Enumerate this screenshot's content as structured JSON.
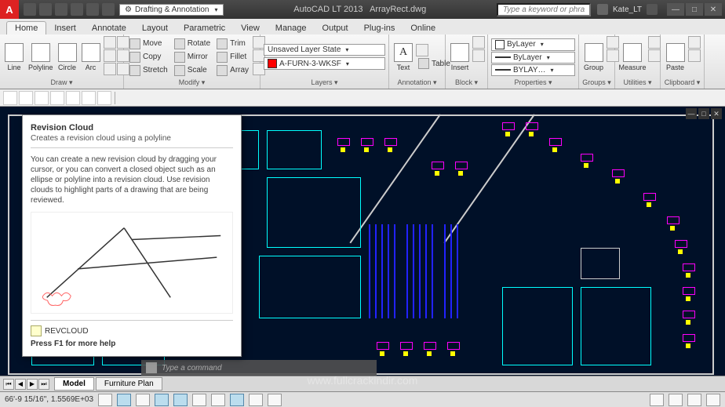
{
  "title": {
    "app": "AutoCAD LT 2013",
    "doc": "ArrayRect.dwg"
  },
  "workspace": "Drafting & Annotation",
  "search_placeholder": "Type a keyword or phrase",
  "user": "Kate_LT",
  "ribbon": {
    "tabs": [
      "Home",
      "Insert",
      "Annotate",
      "Layout",
      "Parametric",
      "View",
      "Manage",
      "Output",
      "Plug-ins",
      "Online"
    ],
    "active": 0,
    "draw": {
      "line": "Line",
      "polyline": "Polyline",
      "circle": "Circle",
      "arc": "Arc",
      "title": "Draw ▾"
    },
    "modify": {
      "row1": [
        "Move",
        "Rotate",
        "Trim"
      ],
      "row2": [
        "Copy",
        "Mirror",
        "Fillet"
      ],
      "row3": [
        "Stretch",
        "Scale",
        "Array"
      ],
      "title": "Modify ▾"
    },
    "layers": {
      "state": "Unsaved Layer State",
      "current": "A-FURN-3-WKSF",
      "title": "Layers ▾"
    },
    "annotation": {
      "text": "Text",
      "table": "Table",
      "title": "Annotation ▾"
    },
    "block": {
      "insert": "Insert",
      "title": "Block ▾"
    },
    "properties": {
      "row1": "ByLayer",
      "row2": "ByLayer",
      "row3": "BYLAY…",
      "title": "Properties ▾"
    },
    "groups": {
      "group": "Group",
      "title": "Groups ▾"
    },
    "utilities": {
      "measure": "Measure",
      "title": "Utilities ▾"
    },
    "clipboard": {
      "paste": "Paste",
      "title": "Clipboard ▾"
    }
  },
  "tooltip": {
    "title": "Revision Cloud",
    "subtitle": "Creates a revision cloud using a polyline",
    "description": "You can create a new revision cloud by dragging your cursor, or you can convert a closed object such as an ellipse or polyline into a revision cloud. Use revision clouds to highlight parts of a drawing that are being reviewed.",
    "command": "REVCLOUD",
    "help": "Press F1 for more help"
  },
  "command_prompt": "Type a command",
  "layout_tabs": [
    "Model",
    "Furniture Plan"
  ],
  "layout_active": 0,
  "status": {
    "coords": "66'-9 15/16\", 1.5569E+03"
  },
  "watermark": "www.fullcrackindir.com"
}
